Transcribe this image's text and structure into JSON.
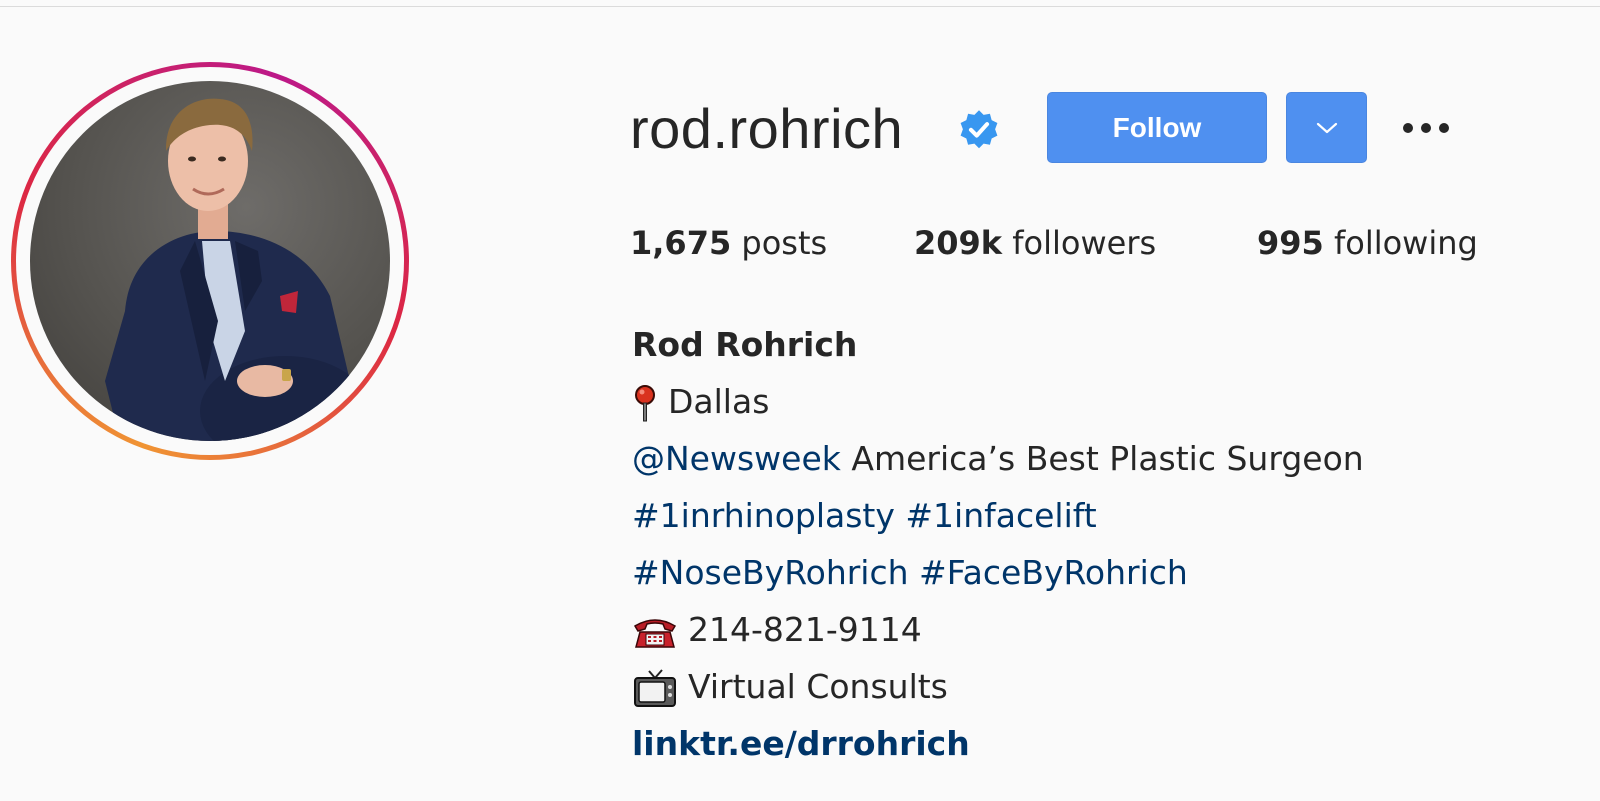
{
  "profile": {
    "username": "rod.rohrich",
    "verified": true,
    "full_name": "Rod Rohrich"
  },
  "actions": {
    "follow_label": "Follow",
    "dropdown_icon": "chevron-down-icon",
    "more_icon": "more-options-icon"
  },
  "stats": {
    "posts_count": "1,675",
    "posts_label": "posts",
    "followers_count": "209k",
    "followers_label": "followers",
    "following_count": "995",
    "following_label": "following"
  },
  "bio": {
    "location_icon": "pushpin-icon",
    "location": "Dallas",
    "mention": "@Newsweek",
    "mention_text": "America’s Best Plastic Surgeon",
    "hashtags_line1": [
      "#1inrhinoplasty",
      "#1infacelift"
    ],
    "hashtags_line2": [
      "#NoseByRohrich",
      "#FaceByRohrich"
    ],
    "phone_icon": "telephone-icon",
    "phone": "214-821-9114",
    "tv_icon": "television-icon",
    "consults": "Virtual Consults",
    "link": "linktr.ee/drrohrich"
  },
  "colors": {
    "follow_button": "#4f90f0",
    "link": "#003569",
    "verified_badge": "#3897f0",
    "background": "#fafafa"
  }
}
